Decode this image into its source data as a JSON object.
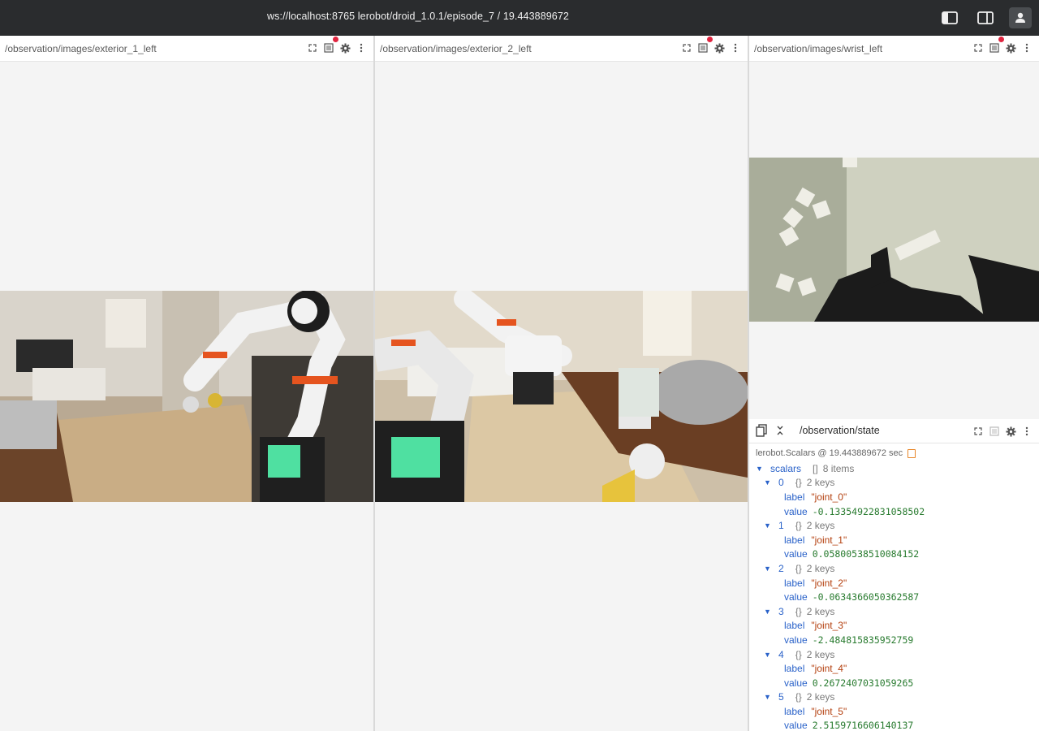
{
  "topbar": {
    "title": "ws://localhost:8765 lerobot/droid_1.0.1/episode_7 / 19.443889672",
    "left_panel_icon": "left-panel-toggle-icon",
    "right_panel_icon": "right-panel-toggle-icon",
    "user_icon": "user-icon"
  },
  "panels": [
    {
      "title": "/observation/images/exterior_1_left"
    },
    {
      "title": "/observation/images/exterior_2_left"
    },
    {
      "title": "/observation/images/wrist_left"
    }
  ],
  "state": {
    "title": "/observation/state",
    "meta": "lerobot.Scalars @ 19.443889672 sec",
    "root_key": "scalars",
    "root_type": "[]",
    "root_count": "8 items",
    "items": [
      {
        "index": "0",
        "type": "{}",
        "count": "2 keys",
        "label_key": "label",
        "label": "\"joint_0\"",
        "value_key": "value",
        "value": "-0.13354922831058502"
      },
      {
        "index": "1",
        "type": "{}",
        "count": "2 keys",
        "label_key": "label",
        "label": "\"joint_1\"",
        "value_key": "value",
        "value": "0.05800538510084152"
      },
      {
        "index": "2",
        "type": "{}",
        "count": "2 keys",
        "label_key": "label",
        "label": "\"joint_2\"",
        "value_key": "value",
        "value": "-0.0634366050362587"
      },
      {
        "index": "3",
        "type": "{}",
        "count": "2 keys",
        "label_key": "label",
        "label": "\"joint_3\"",
        "value_key": "value",
        "value": "-2.484815835952759"
      },
      {
        "index": "4",
        "type": "{}",
        "count": "2 keys",
        "label_key": "label",
        "label": "\"joint_4\"",
        "value_key": "value",
        "value": "0.2672407031059265"
      },
      {
        "index": "5",
        "type": "{}",
        "count": "2 keys",
        "label_key": "label",
        "label": "\"joint_5\"",
        "value_key": "value",
        "value": "2.5159716606140137"
      }
    ]
  },
  "colors": {
    "topbar_bg": "#2a2c2e",
    "record_dot": "#e0243f",
    "link_blue": "#2a62c9",
    "string_orange": "#b4400f",
    "number_green": "#277a2e"
  }
}
